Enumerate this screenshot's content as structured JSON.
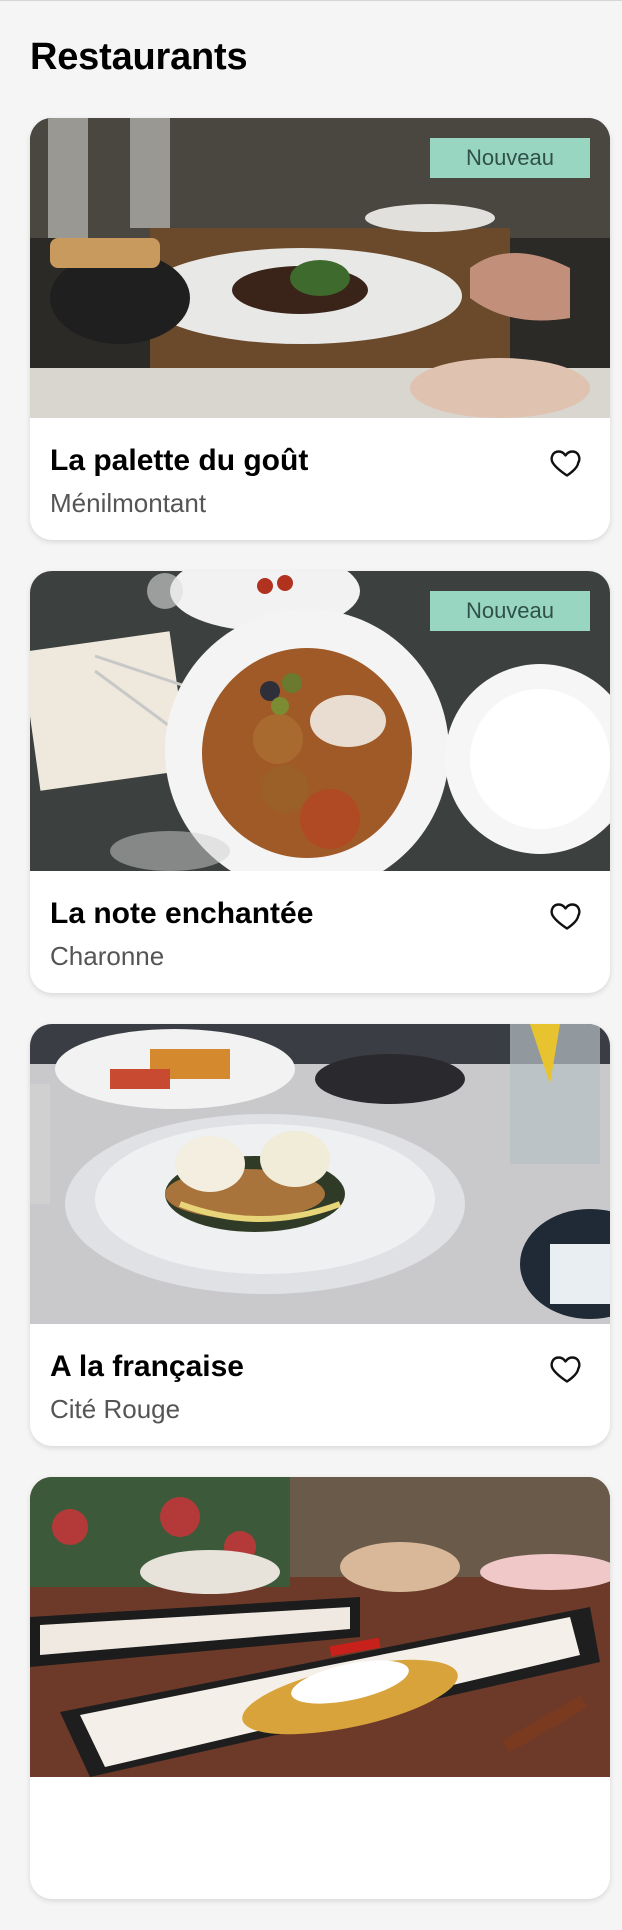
{
  "page": {
    "title": "Restaurants"
  },
  "restaurants": [
    {
      "name": "La palette du goût",
      "area": "Ménilmontant",
      "badge": "Nouveau"
    },
    {
      "name": "La note enchantée",
      "area": "Charonne",
      "badge": "Nouveau"
    },
    {
      "name": "A la française",
      "area": "Cité Rouge",
      "badge": ""
    },
    {
      "name": "",
      "area": "",
      "badge": ""
    }
  ],
  "colors": {
    "badge_bg": "#99d6c2",
    "badge_text": "#2f5148",
    "page_bg": "#f5f5f5"
  },
  "icons": {
    "favorite": "heart-outline-icon"
  }
}
